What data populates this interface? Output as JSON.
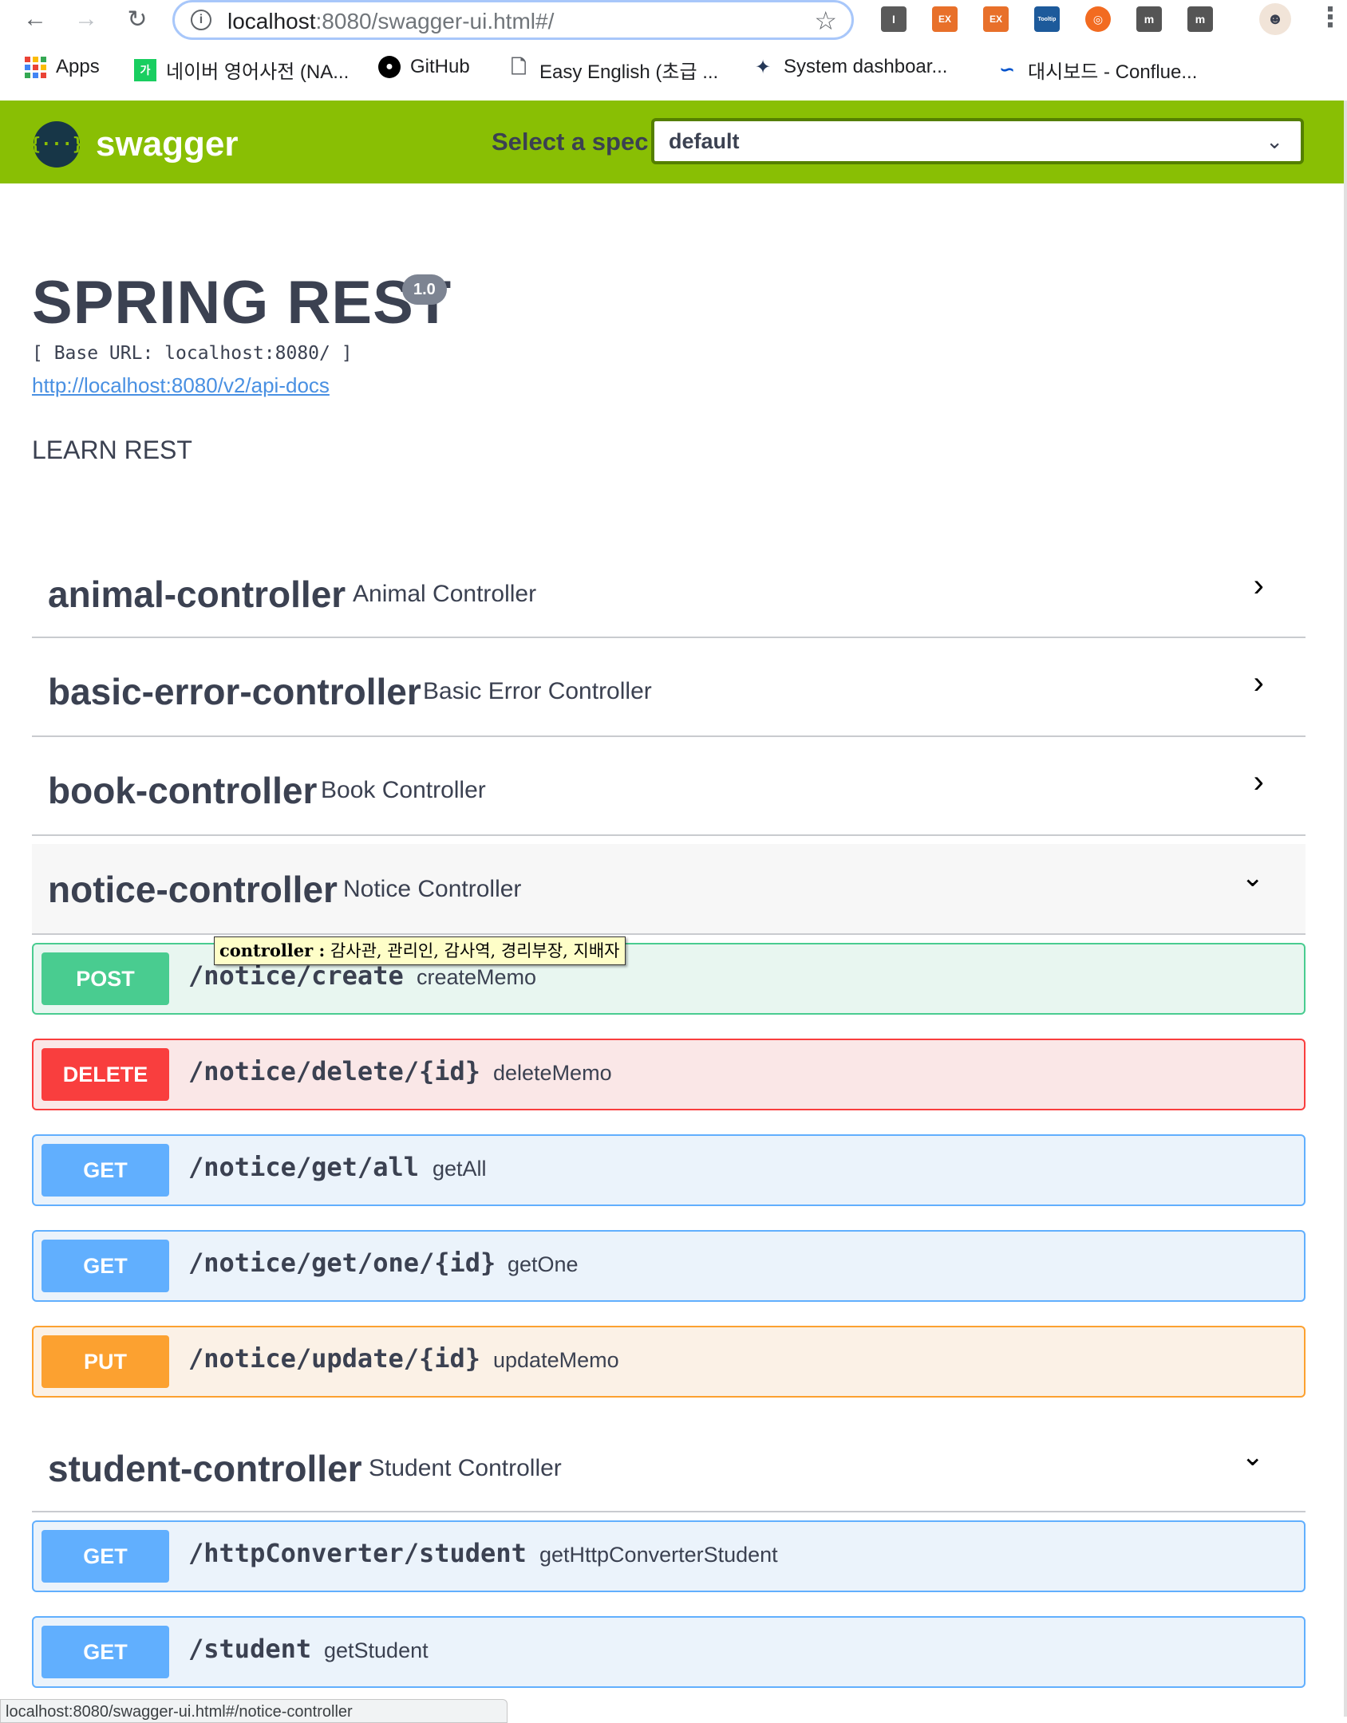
{
  "browser": {
    "url_host": "localhost",
    "url_rest": ":8080/swagger-ui.html#/",
    "bookmarks": [
      {
        "label": "Apps",
        "icon": "apps-grid-icon"
      },
      {
        "label": "네이버 영어사전 (NA...",
        "icon": "naver-dictionary-icon"
      },
      {
        "label": "GitHub",
        "icon": "github-icon"
      },
      {
        "label": "Easy English (초급 ...",
        "icon": "document-icon"
      },
      {
        "label": "System dashboar...",
        "icon": "jira-icon"
      },
      {
        "label": "대시보드 - Conflue...",
        "icon": "confluence-icon"
      }
    ],
    "extensions": [
      "I",
      "EX",
      "EX",
      "Tooltip",
      "",
      "m",
      "m"
    ],
    "status_text": "localhost:8080/swagger-ui.html#/notice-controller"
  },
  "topbar": {
    "brand": "swagger",
    "logo_glyph": "{···}",
    "select_label": "Select a spec",
    "select_value": "default",
    "accent": "#89bf04"
  },
  "info": {
    "title": "SPRING REST",
    "version": "1.0",
    "base_url": "[ Base URL: localhost:8080/ ]",
    "api_docs_link": "http://localhost:8080/v2/api-docs",
    "description": "LEARN REST"
  },
  "tags": [
    {
      "name": "animal-controller",
      "description": "Animal Controller",
      "expanded": false
    },
    {
      "name": "basic-error-controller",
      "description": "Basic Error Controller",
      "expanded": false
    },
    {
      "name": "book-controller",
      "description": "Book Controller",
      "expanded": false
    },
    {
      "name": "notice-controller",
      "description": "Notice Controller",
      "expanded": true
    },
    {
      "name": "student-controller",
      "description": "Student Controller",
      "expanded": true
    }
  ],
  "notice_operations": [
    {
      "method": "POST",
      "path": "/notice/create",
      "summary": "createMemo"
    },
    {
      "method": "DELETE",
      "path": "/notice/delete/{id}",
      "summary": "deleteMemo"
    },
    {
      "method": "GET",
      "path": "/notice/get/all",
      "summary": "getAll"
    },
    {
      "method": "GET",
      "path": "/notice/get/one/{id}",
      "summary": "getOne"
    },
    {
      "method": "PUT",
      "path": "/notice/update/{id}",
      "summary": "updateMemo"
    }
  ],
  "student_operations": [
    {
      "method": "GET",
      "path": "/httpConverter/student",
      "summary": "getHttpConverterStudent"
    },
    {
      "method": "GET",
      "path": "/student",
      "summary": "getStudent"
    }
  ],
  "tooltip": {
    "label": "controller :",
    "text": "감사관, 관리인, 감사역, 경리부장, 지배자"
  },
  "colors": {
    "post": "#49cc90",
    "delete": "#f93e3e",
    "get": "#61affe",
    "put": "#fca130"
  }
}
